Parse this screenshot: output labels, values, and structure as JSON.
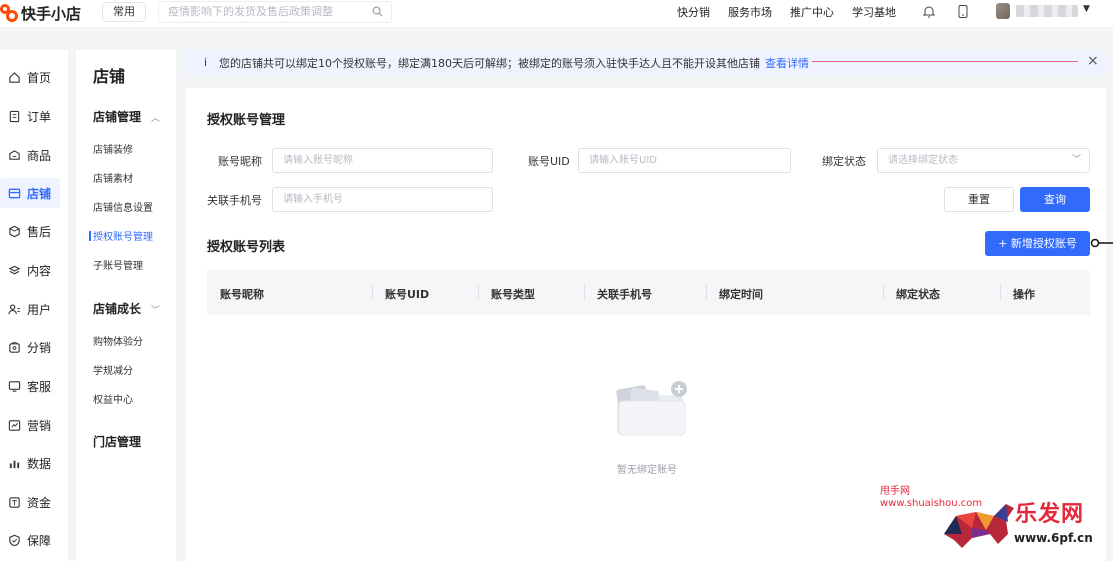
{
  "app": {
    "logo_text": "快手小店",
    "common_label": "常用",
    "search_placeholder": "疫情影响下的发货及售后政策调整",
    "top_links": [
      "快分销",
      "服务市场",
      "推广中心",
      "学习基地"
    ]
  },
  "primary_nav": [
    {
      "label": "首页",
      "icon": "home-icon"
    },
    {
      "label": "订单",
      "icon": "order-icon"
    },
    {
      "label": "商品",
      "icon": "goods-icon"
    },
    {
      "label": "店铺",
      "icon": "shop-icon",
      "active": true
    },
    {
      "label": "售后",
      "icon": "after-sale-icon"
    },
    {
      "label": "内容",
      "icon": "content-icon"
    },
    {
      "label": "用户",
      "icon": "user-icon"
    },
    {
      "label": "分销",
      "icon": "distribution-icon"
    },
    {
      "label": "客服",
      "icon": "customer-service-icon"
    },
    {
      "label": "营销",
      "icon": "marketing-icon"
    },
    {
      "label": "数据",
      "icon": "data-icon"
    },
    {
      "label": "资金",
      "icon": "funds-icon"
    },
    {
      "label": "保障",
      "icon": "guarantee-icon"
    }
  ],
  "secondary_nav": {
    "title": "店铺",
    "groups": [
      {
        "label": "店铺管理",
        "items": [
          "店铺装修",
          "店铺素材",
          "店铺信息设置",
          "授权账号管理",
          "子账号管理"
        ]
      },
      {
        "label": "店铺成长",
        "items": [
          "购物体验分",
          "学规减分",
          "权益中心"
        ]
      },
      {
        "label": "门店管理",
        "items": []
      }
    ],
    "active_item": "授权账号管理"
  },
  "notice": {
    "text": "您的店铺共可以绑定10个授权账号，绑定满180天后可解绑；被绑定的账号须入驻快手达人且不能开设其他店铺",
    "link": "查看详情"
  },
  "form": {
    "title": "授权账号管理",
    "nickname_label": "账号昵称",
    "nickname_placeholder": "请输入账号昵称",
    "uid_label": "账号UID",
    "uid_placeholder": "请输入账号UID",
    "status_label": "绑定状态",
    "status_placeholder": "请选择绑定状态",
    "phone_label": "关联手机号",
    "phone_placeholder": "请输入手机号",
    "reset_label": "重置",
    "search_label": "查询"
  },
  "list": {
    "title": "授权账号列表",
    "add_label": "+ 新增授权账号",
    "columns": [
      "账号昵称",
      "账号UID",
      "账号类型",
      "关联手机号",
      "绑定时间",
      "绑定状态",
      "操作"
    ],
    "rows": [],
    "empty_text": "暂无绑定账号"
  },
  "watermark": {
    "line1": "甩手网",
    "line2": "www.shuaishou.com",
    "brand": "乐发网",
    "url": "www.6pf.cn"
  },
  "colors": {
    "accent": "#326bfb",
    "brand": "#ff4906",
    "watermark": "#e5283b"
  }
}
